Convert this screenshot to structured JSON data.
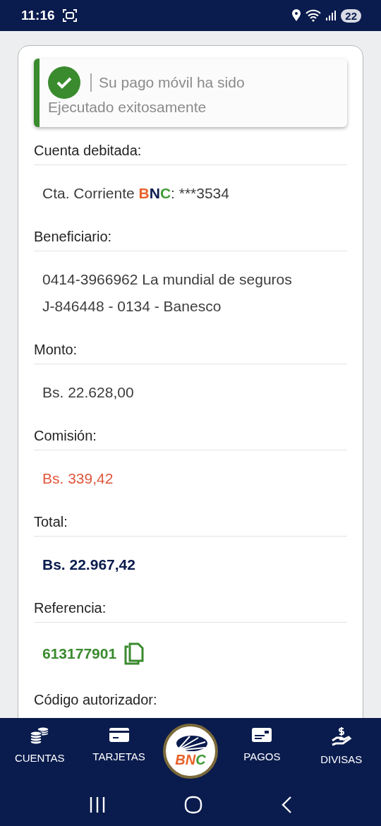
{
  "status_bar": {
    "time": "11:16",
    "battery": "22"
  },
  "alert": {
    "title": "Su pago móvil ha sido",
    "message": "Ejecutado exitosamente"
  },
  "fields": [
    {
      "label": "Cuenta debitada:",
      "kind": "account",
      "parts": [
        {
          "text": "Cta. Corriente ",
          "color": "#3c3c3c"
        },
        {
          "text": "B",
          "color": "#e8622a"
        },
        {
          "text": "N",
          "color": "#0a1b4d"
        },
        {
          "text": "C",
          "color": "#3f9a35"
        },
        {
          "text": ": ***3534",
          "color": "#3c3c3c"
        }
      ]
    },
    {
      "label": "Beneficiario:",
      "kind": "plain",
      "lines": [
        "0414-3966962 La mundial de seguros",
        "J-846448 - 0134 - Banesco"
      ]
    },
    {
      "label": "Monto:",
      "kind": "plain",
      "lines": [
        "Bs. 22.628,00"
      ]
    },
    {
      "label": "Comisión:",
      "kind": "fee",
      "lines": [
        "Bs. 339,42"
      ]
    },
    {
      "label": "Total:",
      "kind": "total",
      "lines": [
        "Bs. 22.967,42"
      ]
    },
    {
      "label": "Referencia:",
      "kind": "reference",
      "lines": [
        "613177901"
      ]
    },
    {
      "label": "Código autorizador:",
      "kind": "cut"
    }
  ],
  "bottom_nav": [
    {
      "label": "CUENTAS",
      "kind": "coins"
    },
    {
      "label": "TARJETAS",
      "kind": "card"
    },
    {
      "label": "BNC",
      "kind": "logo"
    },
    {
      "label": "PAGOS",
      "kind": "payments"
    },
    {
      "label": "DIVISAS",
      "kind": "currency"
    }
  ]
}
